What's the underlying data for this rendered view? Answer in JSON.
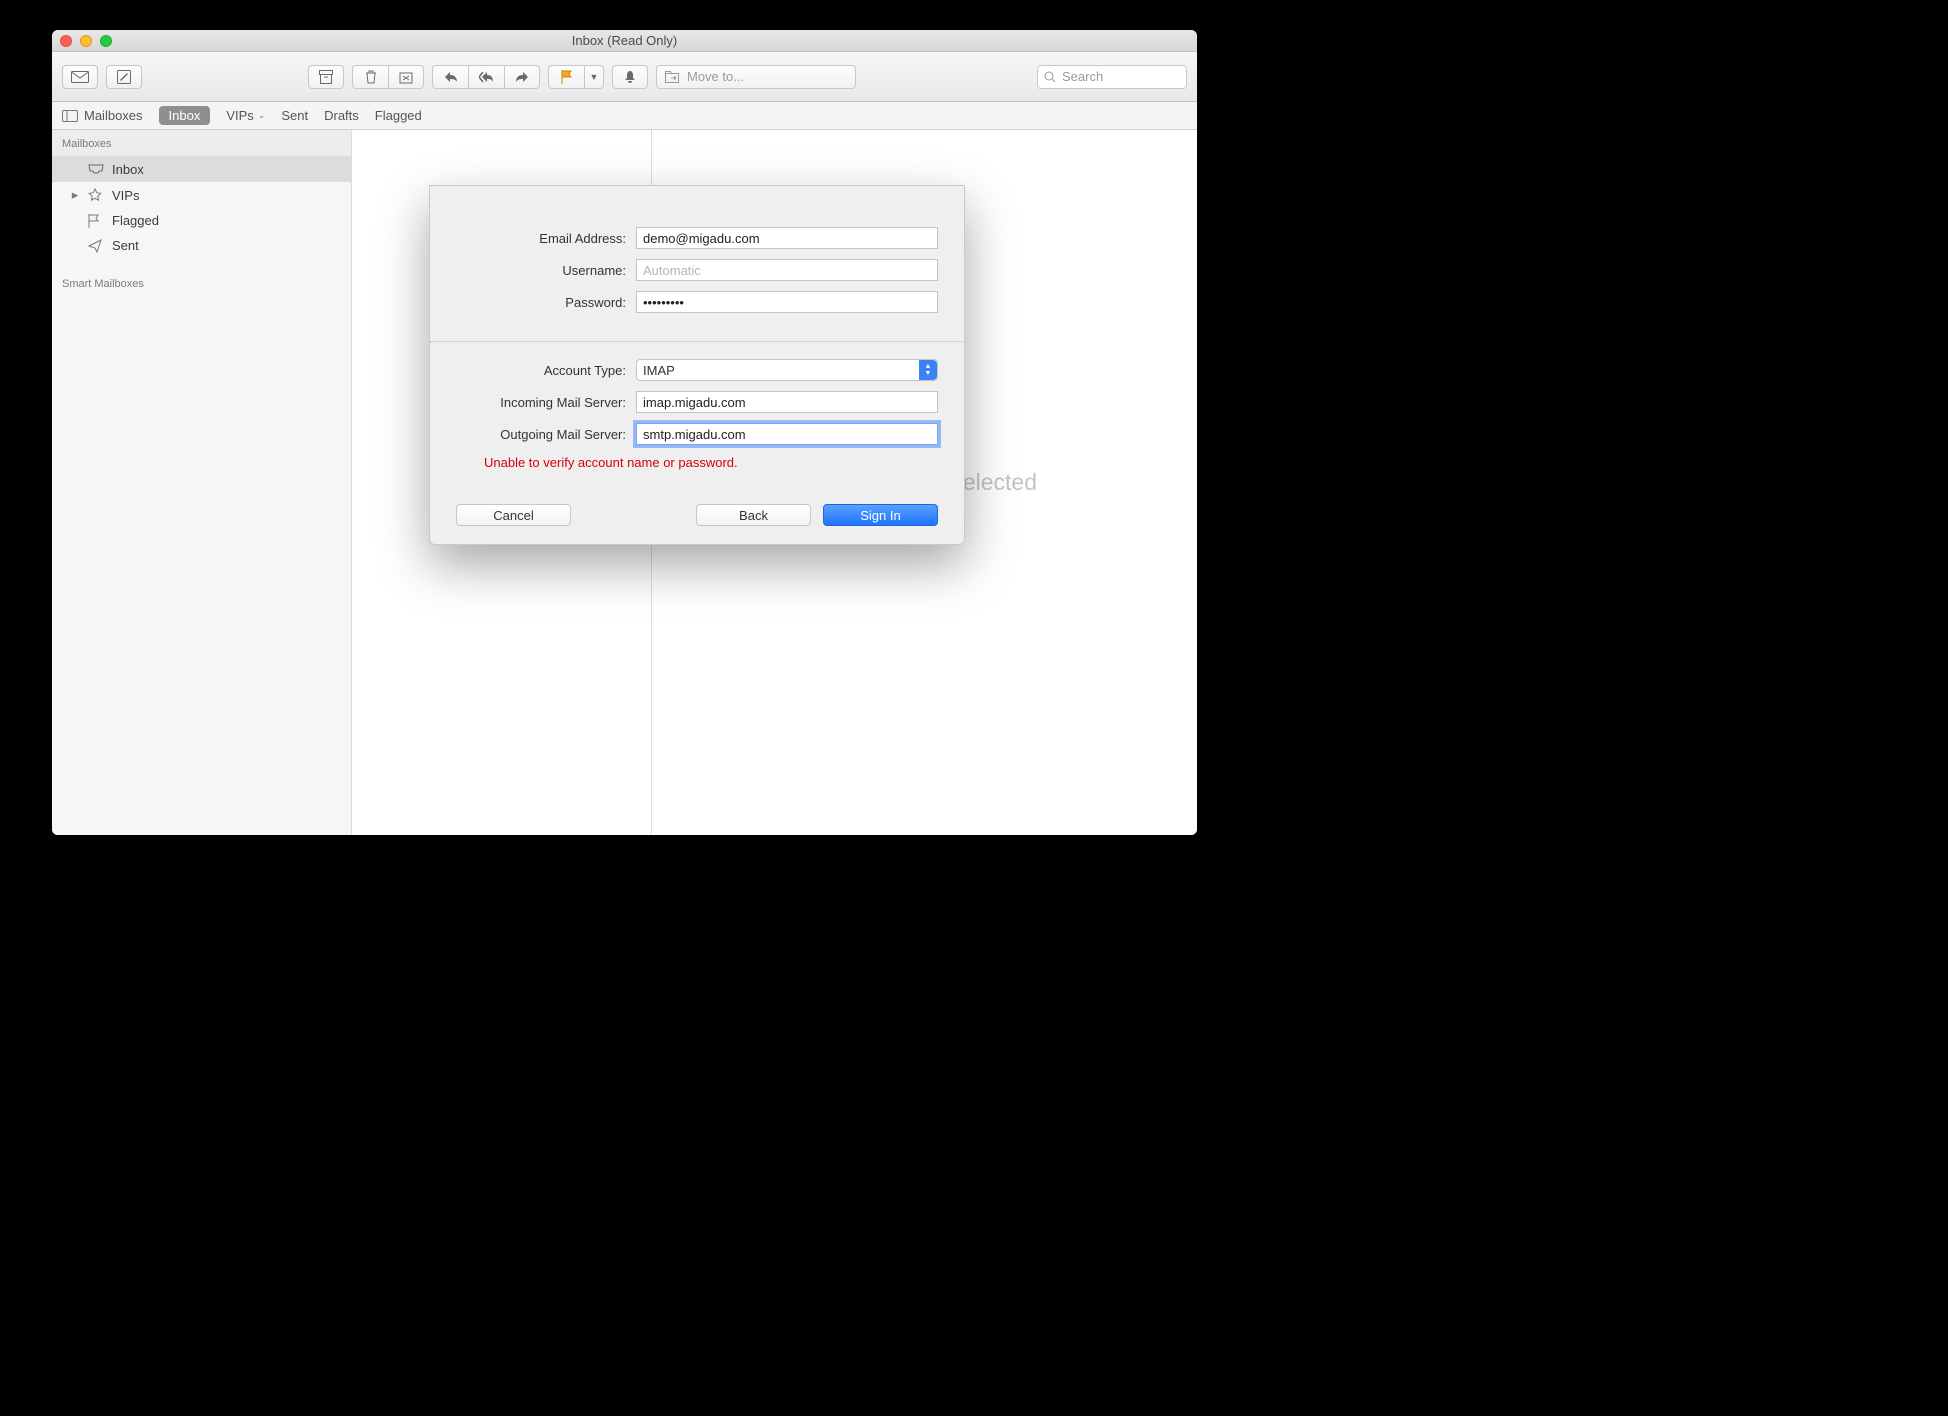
{
  "window": {
    "title": "Inbox (Read Only)"
  },
  "toolbar": {
    "moveto_placeholder": "Move to...",
    "search_placeholder": "Search"
  },
  "favbar": {
    "mailboxes": "Mailboxes",
    "inbox": "Inbox",
    "vips": "VIPs",
    "sent": "Sent",
    "drafts": "Drafts",
    "flagged": "Flagged"
  },
  "sidebar": {
    "header_mailboxes": "Mailboxes",
    "inbox": "Inbox",
    "vips": "VIPs",
    "flagged": "Flagged",
    "sent": "Sent",
    "header_smart": "Smart Mailboxes"
  },
  "msgview": {
    "empty": "No Message Selected"
  },
  "sheet": {
    "labels": {
      "email": "Email Address:",
      "username": "Username:",
      "password": "Password:",
      "account_type": "Account Type:",
      "incoming": "Incoming Mail Server:",
      "outgoing": "Outgoing Mail Server:"
    },
    "values": {
      "email": "demo@migadu.com",
      "username_placeholder": "Automatic",
      "password": "•••••••••",
      "account_type": "IMAP",
      "incoming": "imap.migadu.com",
      "outgoing": "smtp.migadu.com"
    },
    "error": "Unable to verify account name or password.",
    "buttons": {
      "cancel": "Cancel",
      "back": "Back",
      "signin": "Sign In"
    }
  }
}
